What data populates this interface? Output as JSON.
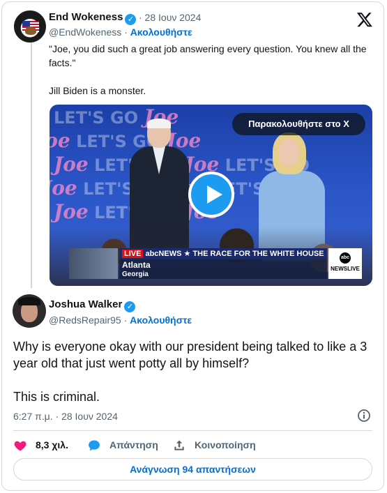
{
  "quoted": {
    "name": "End Wokeness",
    "date": "· 28 Ιουν 2024",
    "handle": "@EndWokeness",
    "separator": " · ",
    "follow": "Ακολουθήστε",
    "text_line1": "\"Joe, you did such a great job answering every question. You knew all the facts.\"",
    "text_line2": "Jill Biden is a monster.",
    "video": {
      "watch_label": "Παρακολουθήστε στο X",
      "bg_words": "LET'S GO",
      "bg_joe": "Joe",
      "lower_third": {
        "live": "LIVE",
        "network": "abcNEWS",
        "headline": "★ THE RACE FOR THE WHITE HOUSE",
        "city": "Atlanta",
        "state": "Georgia",
        "logo_disc": "abc",
        "logo_text": "NEWSLIVE"
      }
    }
  },
  "main": {
    "name": "Joshua Walker",
    "handle": "@RedsRepair95",
    "separator": " · ",
    "follow": "Ακολουθήστε",
    "text_line1": "Why is everyone okay with our president being talked to like a 3 year old that just went potty all by himself?",
    "text_line2": "This is criminal.",
    "timestamp": "6:27 π.μ. · 28 Ιουν 2024"
  },
  "actions": {
    "likes": "8,3 χιλ.",
    "reply": "Απάντηση",
    "share": "Κοινοποίηση"
  },
  "read_replies": "Ανάγνωση 94 απαντήσεων",
  "colors": {
    "accent": "#1d9bf0",
    "link": "#006fd6",
    "like": "#f91880",
    "muted": "#536471",
    "border": "#cfd9de"
  }
}
